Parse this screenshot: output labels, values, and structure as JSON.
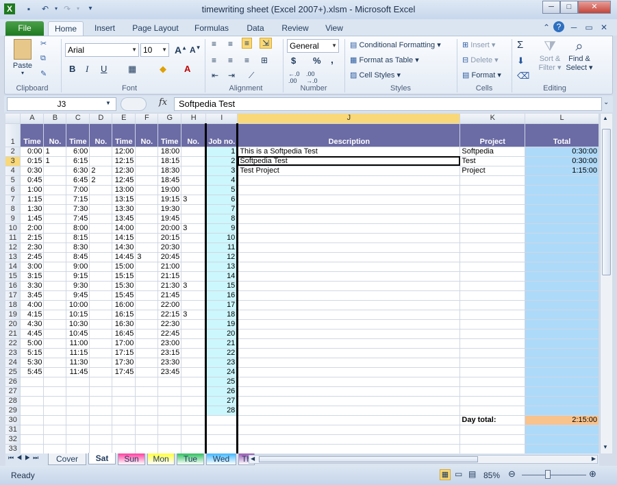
{
  "window": {
    "title": "timewriting sheet (Excel 2007+).xlsm - Microsoft Excel"
  },
  "tabs": [
    "File",
    "Home",
    "Insert",
    "Page Layout",
    "Formulas",
    "Data",
    "Review",
    "View"
  ],
  "ribbon": {
    "clipboard": {
      "label": "Clipboard",
      "paste": "Paste"
    },
    "font": {
      "label": "Font",
      "name": "Arial",
      "size": "10",
      "bold": "B",
      "italic": "I",
      "underline": "U"
    },
    "alignment": {
      "label": "Alignment"
    },
    "number": {
      "label": "Number",
      "format": "General",
      "currency": "$",
      "percent": "%",
      "comma": ","
    },
    "styles": {
      "label": "Styles",
      "conditional": "Conditional Formatting",
      "format_table": "Format as Table",
      "cell_styles": "Cell Styles"
    },
    "cells": {
      "label": "Cells",
      "insert": "Insert",
      "delete": "Delete",
      "format": "Format"
    },
    "editing": {
      "label": "Editing",
      "sum": "Σ",
      "sort": "Sort &",
      "filter": "Filter",
      "find": "Find &",
      "select": "Select"
    }
  },
  "formula_bar": {
    "name_box": "J3",
    "fx": "fx",
    "content": "Softpedia Test"
  },
  "columns": [
    "A",
    "B",
    "C",
    "D",
    "E",
    "F",
    "G",
    "H",
    "I",
    "J",
    "K",
    "L"
  ],
  "header_row": [
    "Time",
    "No.",
    "Time",
    "No.",
    "Time",
    "No.",
    "Time",
    "No.",
    "Job no.",
    "Description",
    "Project",
    "Total"
  ],
  "rows": [
    {
      "r": "2",
      "a": "0:00",
      "b": "1",
      "c": "6:00",
      "d": "",
      "e": "12:00",
      "f": "",
      "g": "18:00",
      "h": "",
      "i": "1",
      "j": "This is a Softpedia Test",
      "k": "Softpedia",
      "l": "0:30:00"
    },
    {
      "r": "3",
      "a": "0:15",
      "b": "1",
      "c": "6:15",
      "d": "",
      "e": "12:15",
      "f": "",
      "g": "18:15",
      "h": "",
      "i": "2",
      "j": "Softpedia Test",
      "k": "Test",
      "l": "0:30:00"
    },
    {
      "r": "4",
      "a": "0:30",
      "b": "",
      "c": "6:30",
      "d": "2",
      "e": "12:30",
      "f": "",
      "g": "18:30",
      "h": "",
      "i": "3",
      "j": "Test Project",
      "k": "Project",
      "l": "1:15:00"
    },
    {
      "r": "5",
      "a": "0:45",
      "b": "",
      "c": "6:45",
      "d": "2",
      "e": "12:45",
      "f": "",
      "g": "18:45",
      "h": "",
      "i": "4",
      "j": "",
      "k": "",
      "l": ""
    },
    {
      "r": "6",
      "a": "1:00",
      "b": "",
      "c": "7:00",
      "d": "",
      "e": "13:00",
      "f": "",
      "g": "19:00",
      "h": "",
      "i": "5",
      "j": "",
      "k": "",
      "l": ""
    },
    {
      "r": "7",
      "a": "1:15",
      "b": "",
      "c": "7:15",
      "d": "",
      "e": "13:15",
      "f": "",
      "g": "19:15",
      "h": "3",
      "i": "6",
      "j": "",
      "k": "",
      "l": ""
    },
    {
      "r": "8",
      "a": "1:30",
      "b": "",
      "c": "7:30",
      "d": "",
      "e": "13:30",
      "f": "",
      "g": "19:30",
      "h": "",
      "i": "7",
      "j": "",
      "k": "",
      "l": ""
    },
    {
      "r": "9",
      "a": "1:45",
      "b": "",
      "c": "7:45",
      "d": "",
      "e": "13:45",
      "f": "",
      "g": "19:45",
      "h": "",
      "i": "8",
      "j": "",
      "k": "",
      "l": ""
    },
    {
      "r": "10",
      "a": "2:00",
      "b": "",
      "c": "8:00",
      "d": "",
      "e": "14:00",
      "f": "",
      "g": "20:00",
      "h": "3",
      "i": "9",
      "j": "",
      "k": "",
      "l": ""
    },
    {
      "r": "11",
      "a": "2:15",
      "b": "",
      "c": "8:15",
      "d": "",
      "e": "14:15",
      "f": "",
      "g": "20:15",
      "h": "",
      "i": "10",
      "j": "",
      "k": "",
      "l": ""
    },
    {
      "r": "12",
      "a": "2:30",
      "b": "",
      "c": "8:30",
      "d": "",
      "e": "14:30",
      "f": "",
      "g": "20:30",
      "h": "",
      "i": "11",
      "j": "",
      "k": "",
      "l": ""
    },
    {
      "r": "13",
      "a": "2:45",
      "b": "",
      "c": "8:45",
      "d": "",
      "e": "14:45",
      "f": "3",
      "g": "20:45",
      "h": "",
      "i": "12",
      "j": "",
      "k": "",
      "l": ""
    },
    {
      "r": "14",
      "a": "3:00",
      "b": "",
      "c": "9:00",
      "d": "",
      "e": "15:00",
      "f": "",
      "g": "21:00",
      "h": "",
      "i": "13",
      "j": "",
      "k": "",
      "l": ""
    },
    {
      "r": "15",
      "a": "3:15",
      "b": "",
      "c": "9:15",
      "d": "",
      "e": "15:15",
      "f": "",
      "g": "21:15",
      "h": "",
      "i": "14",
      "j": "",
      "k": "",
      "l": ""
    },
    {
      "r": "16",
      "a": "3:30",
      "b": "",
      "c": "9:30",
      "d": "",
      "e": "15:30",
      "f": "",
      "g": "21:30",
      "h": "3",
      "i": "15",
      "j": "",
      "k": "",
      "l": ""
    },
    {
      "r": "17",
      "a": "3:45",
      "b": "",
      "c": "9:45",
      "d": "",
      "e": "15:45",
      "f": "",
      "g": "21:45",
      "h": "",
      "i": "16",
      "j": "",
      "k": "",
      "l": ""
    },
    {
      "r": "18",
      "a": "4:00",
      "b": "",
      "c": "10:00",
      "d": "",
      "e": "16:00",
      "f": "",
      "g": "22:00",
      "h": "",
      "i": "17",
      "j": "",
      "k": "",
      "l": ""
    },
    {
      "r": "19",
      "a": "4:15",
      "b": "",
      "c": "10:15",
      "d": "",
      "e": "16:15",
      "f": "",
      "g": "22:15",
      "h": "3",
      "i": "18",
      "j": "",
      "k": "",
      "l": ""
    },
    {
      "r": "20",
      "a": "4:30",
      "b": "",
      "c": "10:30",
      "d": "",
      "e": "16:30",
      "f": "",
      "g": "22:30",
      "h": "",
      "i": "19",
      "j": "",
      "k": "",
      "l": ""
    },
    {
      "r": "21",
      "a": "4:45",
      "b": "",
      "c": "10:45",
      "d": "",
      "e": "16:45",
      "f": "",
      "g": "22:45",
      "h": "",
      "i": "20",
      "j": "",
      "k": "",
      "l": ""
    },
    {
      "r": "22",
      "a": "5:00",
      "b": "",
      "c": "11:00",
      "d": "",
      "e": "17:00",
      "f": "",
      "g": "23:00",
      "h": "",
      "i": "21",
      "j": "",
      "k": "",
      "l": ""
    },
    {
      "r": "23",
      "a": "5:15",
      "b": "",
      "c": "11:15",
      "d": "",
      "e": "17:15",
      "f": "",
      "g": "23:15",
      "h": "",
      "i": "22",
      "j": "",
      "k": "",
      "l": ""
    },
    {
      "r": "24",
      "a": "5:30",
      "b": "",
      "c": "11:30",
      "d": "",
      "e": "17:30",
      "f": "",
      "g": "23:30",
      "h": "",
      "i": "23",
      "j": "",
      "k": "",
      "l": ""
    },
    {
      "r": "25",
      "a": "5:45",
      "b": "",
      "c": "11:45",
      "d": "",
      "e": "17:45",
      "f": "",
      "g": "23:45",
      "h": "",
      "i": "24",
      "j": "",
      "k": "",
      "l": ""
    },
    {
      "r": "26",
      "a": "",
      "b": "",
      "c": "",
      "d": "",
      "e": "",
      "f": "",
      "g": "",
      "h": "",
      "i": "25",
      "j": "",
      "k": "",
      "l": ""
    },
    {
      "r": "27",
      "a": "",
      "b": "",
      "c": "",
      "d": "",
      "e": "",
      "f": "",
      "g": "",
      "h": "",
      "i": "26",
      "j": "",
      "k": "",
      "l": ""
    },
    {
      "r": "28",
      "a": "",
      "b": "",
      "c": "",
      "d": "",
      "e": "",
      "f": "",
      "g": "",
      "h": "",
      "i": "27",
      "j": "",
      "k": "",
      "l": ""
    },
    {
      "r": "29",
      "a": "",
      "b": "",
      "c": "",
      "d": "",
      "e": "",
      "f": "",
      "g": "",
      "h": "",
      "i": "28",
      "j": "",
      "k": "",
      "l": ""
    },
    {
      "r": "30",
      "a": "",
      "b": "",
      "c": "",
      "d": "",
      "e": "",
      "f": "",
      "g": "",
      "h": "",
      "i": "",
      "j": "",
      "k": "Day total:",
      "l": "2:15:00"
    },
    {
      "r": "31",
      "a": "",
      "b": "",
      "c": "",
      "d": "",
      "e": "",
      "f": "",
      "g": "",
      "h": "",
      "i": "",
      "j": "",
      "k": "",
      "l": ""
    },
    {
      "r": "32",
      "a": "",
      "b": "",
      "c": "",
      "d": "",
      "e": "",
      "f": "",
      "g": "",
      "h": "",
      "i": "",
      "j": "",
      "k": "",
      "l": ""
    },
    {
      "r": "33",
      "a": "",
      "b": "",
      "c": "",
      "d": "",
      "e": "",
      "f": "",
      "g": "",
      "h": "",
      "i": "",
      "j": "",
      "k": "",
      "l": ""
    }
  ],
  "sheet_tabs": [
    {
      "label": "Cover",
      "color": "#eef2f7"
    },
    {
      "label": "Sat",
      "color": "#ffffff"
    },
    {
      "label": "Sun",
      "color": "#ff3fa0"
    },
    {
      "label": "Mon",
      "color": "#ffff40"
    },
    {
      "label": "Tue",
      "color": "#30c060"
    },
    {
      "label": "Wed",
      "color": "#40b8ff"
    },
    {
      "label": "Th",
      "color": "#9b59b6"
    }
  ],
  "status": {
    "ready": "Ready",
    "zoom": "85%"
  },
  "colors": {
    "header_bg": "#6b6ba5",
    "job_bg": "#ccf7fc",
    "total_bg": "#aedaf9",
    "day_total_bg": "#f8c38d",
    "file_tab": "#1f7a1f"
  }
}
